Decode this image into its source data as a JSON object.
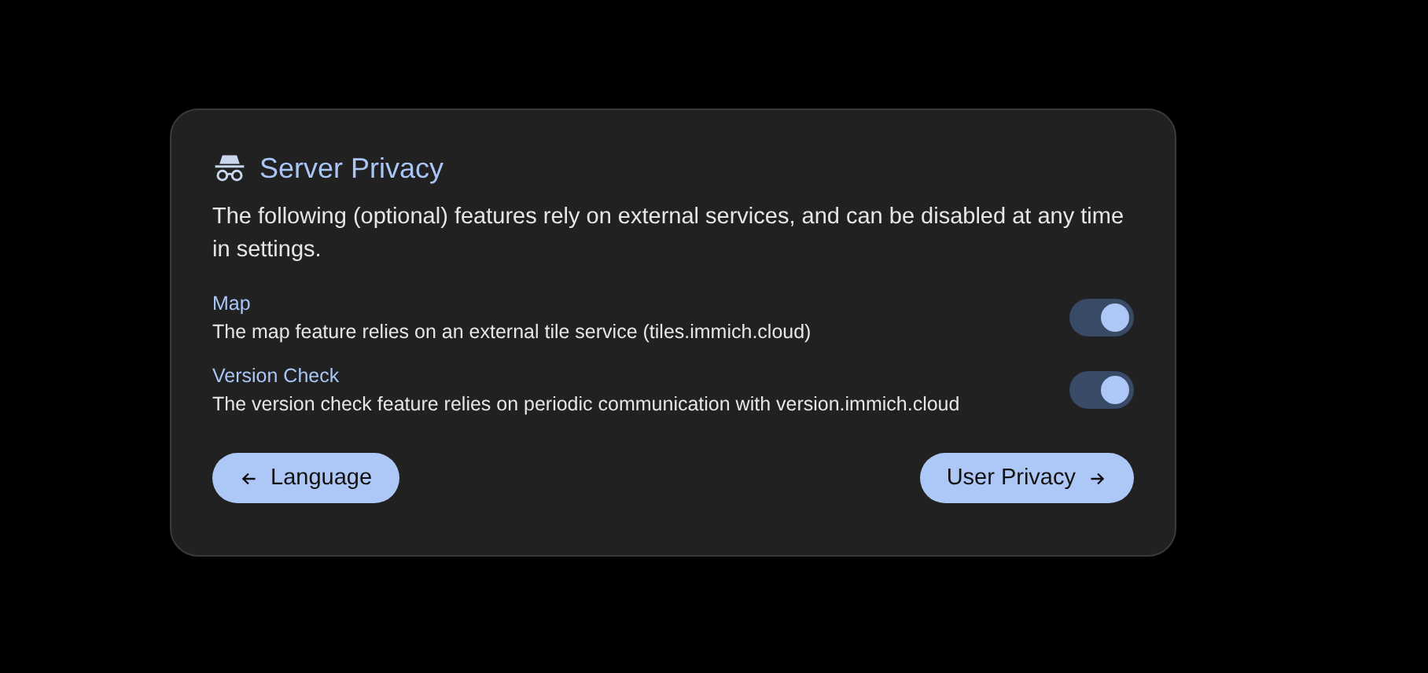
{
  "card": {
    "title": "Server Privacy",
    "description": "The following (optional) features rely on external services, and can be disabled at any time in settings.",
    "settings": [
      {
        "label": "Map",
        "description": "The map feature relies on an external tile service (tiles.immich.cloud)",
        "on": true
      },
      {
        "label": "Version Check",
        "description": "The version check feature relies on periodic communication with version.immich.cloud",
        "on": true
      }
    ],
    "buttons": [
      {
        "label": "Language",
        "kind": "back"
      },
      {
        "label": "User Privacy",
        "kind": "next"
      }
    ]
  }
}
